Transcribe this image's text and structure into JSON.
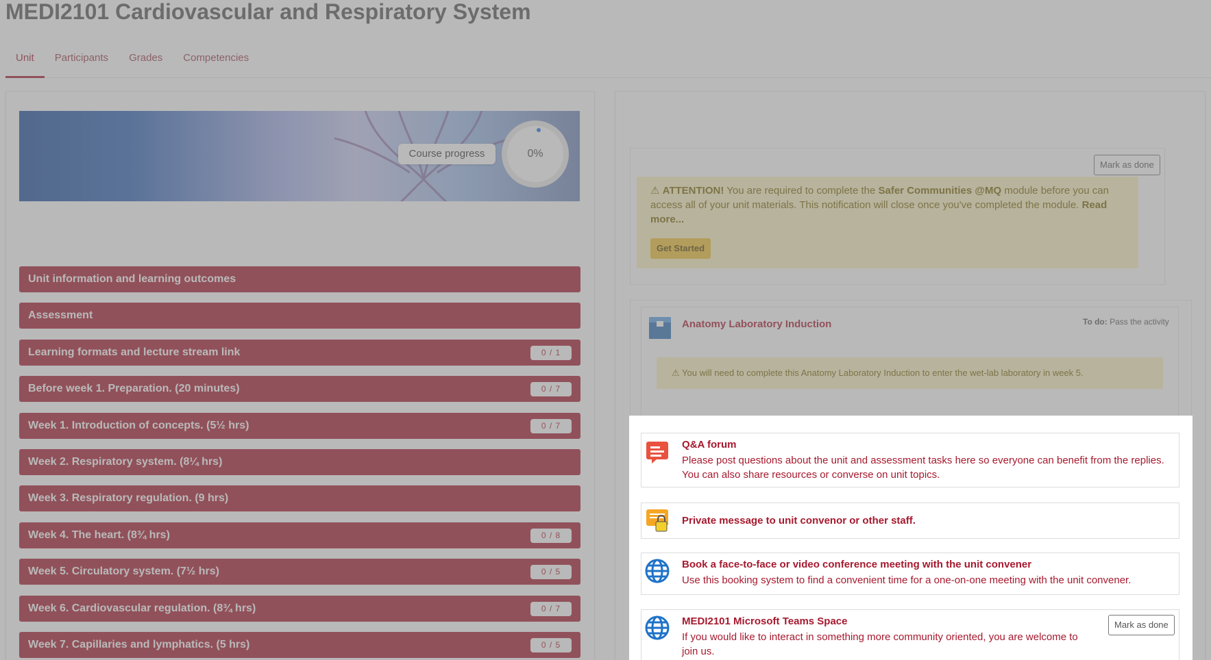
{
  "page": {
    "title": "MEDI2101 Cardiovascular and Respiratory System"
  },
  "tabs": [
    {
      "label": "Unit"
    },
    {
      "label": "Participants"
    },
    {
      "label": "Grades"
    },
    {
      "label": "Competencies"
    }
  ],
  "banner": {
    "progress_label": "Course progress",
    "progress_value": "0%",
    "progress_fraction": 0
  },
  "sections": [
    {
      "label": "Unit information and learning outcomes",
      "count": ""
    },
    {
      "label": "Assessment",
      "count": ""
    },
    {
      "label": "Learning formats and lecture stream link",
      "count": "0 / 1"
    },
    {
      "label": "Before week 1. Preparation. (20 minutes)",
      "count": "0 / 7"
    },
    {
      "label": "Week 1. Introduction of concepts. (5½ hrs)",
      "count": "0 / 7"
    },
    {
      "label": "Week 2. Respiratory system. (8¼ hrs)",
      "count": ""
    },
    {
      "label": "Week 3. Respiratory regulation. (9 hrs)",
      "count": ""
    },
    {
      "label": "Week 4. The heart. (8¾ hrs)",
      "count": "0 / 8"
    },
    {
      "label": "Week 5. Circulatory system. (7½ hrs)",
      "count": "0 / 5"
    },
    {
      "label": "Week 6. Cardiovascular regulation. (8¾ hrs)",
      "count": "0 / 7"
    },
    {
      "label": "Week 7. Capillaries and lymphatics. (5 hrs)",
      "count": "0 / 5"
    }
  ],
  "attention": {
    "mark_done": "Mark as done",
    "prefix": "ATTENTION!",
    "text1": " You are required to complete the ",
    "emph": "Safer Communities @MQ",
    "text2": " module before you can access all of your unit materials. This notification will close once you've completed the module. ",
    "read_more": "Read more...",
    "button": "Get Started"
  },
  "anatomy": {
    "title": "Anatomy Laboratory Induction",
    "todo_label": "To do:",
    "todo_value": "Pass the activity",
    "warning": "You will need to complete this Anatomy Laboratory Induction to enter the wet-lab laboratory in week 5."
  },
  "activities": [
    {
      "title": "Q&A forum",
      "desc_line1": "Please post questions about the unit and assessment tasks here so everyone can benefit from the replies.",
      "desc_line2": "You can also share resources or converse on unit topics."
    },
    {
      "title": "Private message to unit convenor or other staff."
    },
    {
      "title": "Book a face-to-face or video conference meeting with the unit convener",
      "desc_line1": "Use this booking system to find a convenient time for a one-on-one meeting with the unit convener."
    },
    {
      "title": "MEDI2101 Microsoft Teams Space",
      "desc_line1": "If you would like to interact in something more community oriented, you are welcome to",
      "desc_line2": "join us.",
      "mark_done": "Mark as done"
    }
  ],
  "colors": {
    "brand": "#a6192e",
    "warning_bg": "#fdf1c2",
    "overlay": "#808080"
  }
}
